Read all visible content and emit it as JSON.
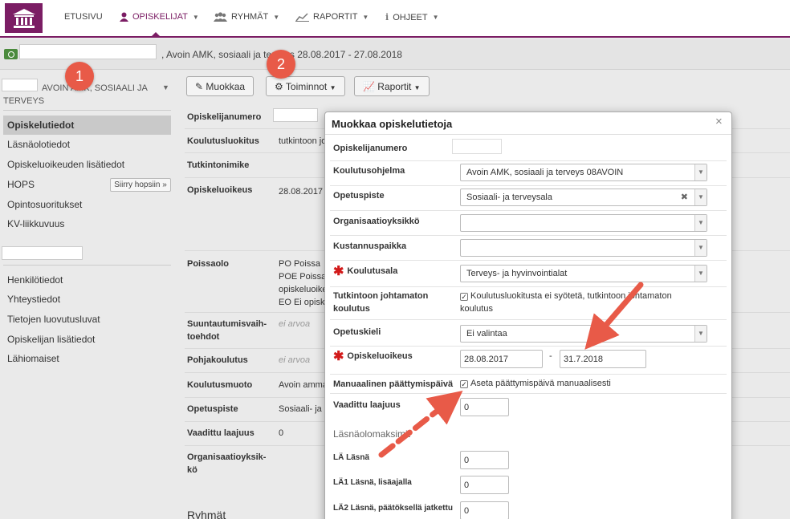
{
  "topnav": {
    "items": [
      {
        "label": "ETUSIVU",
        "icon": ""
      },
      {
        "label": "OPISKELIJAT",
        "icon": "user-icon",
        "active": true
      },
      {
        "label": "RYHMÄT",
        "icon": "group-icon"
      },
      {
        "label": "RAPORTIT",
        "icon": "chart-icon"
      },
      {
        "label": "OHJEET",
        "icon": "info-icon"
      }
    ],
    "brand_color": "#7b1d64"
  },
  "subhead": {
    "text": ", Avoin AMK, sosiaali ja terveys 28.08.2017 - 27.08.2018"
  },
  "sidebar": {
    "program": "AVOIN AMK, SOSIAALI JA TERVEYS",
    "group1": [
      "Opiskelutiedot",
      "Läsnäolotiedot",
      "Opiskeluoikeuden lisätiedot",
      "HOPS",
      "Opintosuoritukset",
      "KV-liikkuvuus"
    ],
    "hops_button": "Siirry hopsiin »",
    "group2": [
      "Henkilötiedot",
      "Yhteystiedot",
      "Tietojen luovutusluvat",
      "Opiskelijan lisätiedot",
      "Lähiomaiset"
    ]
  },
  "toolbar": {
    "edit": "Muokkaa",
    "actions": "Toiminnot",
    "reports": "Raportit"
  },
  "fields": [
    {
      "label": "Opiskelijanumero",
      "value": ""
    },
    {
      "label": "Koulutusluokitus",
      "value": "tutkintoon jo"
    },
    {
      "label": "Tutkintonimike",
      "value": ""
    },
    {
      "label": "Opiskeluoikeus",
      "value": "28.08.2017"
    },
    {
      "label": "Poissaolo",
      "value": "PO Poissa",
      "value2": "POE Poissa",
      "value3": "opiskeluoike",
      "value4": "EO Ei opisk"
    },
    {
      "label": "Suuntautumisvaih-",
      "label2": "toehdot",
      "value": "ei arvoa"
    },
    {
      "label": "Pohjakoulutus",
      "value": "ei arvoa"
    },
    {
      "label": "Koulutusmuoto",
      "value": "Avoin amma"
    },
    {
      "label": "Opetuspiste",
      "value": "Sosiaali- ja"
    },
    {
      "label": "Vaadittu laajuus",
      "value": "0"
    },
    {
      "label": "Organisaatioyksik-",
      "label2": "kö",
      "value": ""
    }
  ],
  "groups_heading": "Ryhmät",
  "modal": {
    "title": "Muokkaa opiskelutietoja",
    "close": "×",
    "rows": {
      "student_number": "Opiskelijanumero",
      "program_label": "Koulutusohjelma",
      "program_value": "Avoin AMK, sosiaali ja terveys 08AVOIN",
      "teaching_point_label": "Opetuspiste",
      "teaching_point_value": "Sosiaali- ja terveysala",
      "org_unit_label": "Organisaatioyksikkö",
      "cost_center_label": "Kustannuspaikka",
      "field_label": "Koulutusala",
      "field_value": "Terveys- ja hyvinvointialat",
      "non_degree_label1": "Tutkintoon johtamaton",
      "non_degree_label2": "koulutus",
      "non_degree_check1": "Koulutusluokitusta ei syötetä, tutkintoon johtamaton",
      "non_degree_check2": "koulutus",
      "language_label": "Opetuskieli",
      "language_value": "Ei valintaa",
      "right_label": "Opiskeluoikeus",
      "right_start": "28.08.2017",
      "right_dash": "-",
      "right_end": "31.7.2018",
      "manual_end_label": "Manuaalinen päättymispäivä",
      "manual_end_check": "Aseta päättymispäivä manuaalisesti",
      "required_credits_label": "Vaadittu laajuus",
      "required_credits_value": "0",
      "presence_heading": "Läsnäolomaksimit",
      "la_label": "LÄ Läsnä",
      "la_value": "0",
      "la1_label": "LÄ1 Läsnä, lisäajalla",
      "la1_value": "0",
      "la2_label": "LÄ2 Läsnä, päätöksellä jatkettu",
      "la2_value": "0"
    }
  },
  "annotations": {
    "badge1": "1",
    "badge2": "2",
    "arrow_color": "#e85a48"
  }
}
